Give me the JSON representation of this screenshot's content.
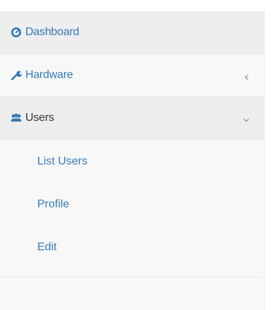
{
  "sidebar": {
    "items": [
      {
        "label": "Dashboard",
        "icon": "dashboard-icon"
      },
      {
        "label": "Hardware",
        "icon": "wrench-icon",
        "chevron": "chevron-left-icon"
      },
      {
        "label": "Users",
        "icon": "users-icon",
        "chevron": "chevron-down-icon"
      }
    ],
    "users_subitems": [
      {
        "label": "List Users"
      },
      {
        "label": "Profile"
      },
      {
        "label": "Edit"
      }
    ]
  },
  "colors": {
    "link": "#337ab7",
    "sidebar_bg": "#f8f8f8",
    "active_bg": "#eeeeee",
    "border": "#e7e7e7",
    "active_text": "#333333",
    "chevron": "#999999"
  }
}
